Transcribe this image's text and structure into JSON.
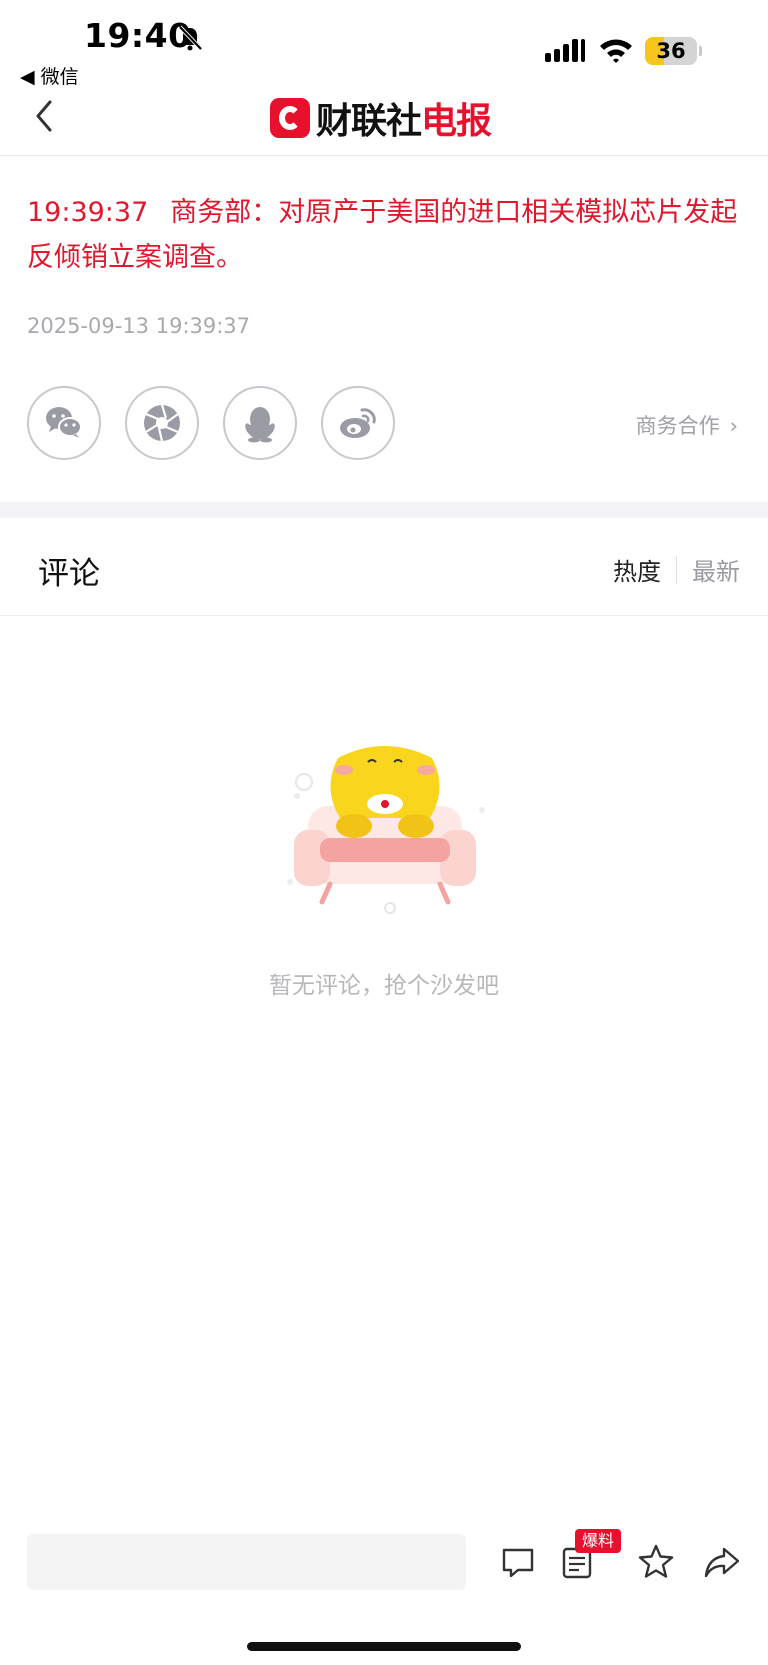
{
  "status_bar": {
    "time": "19:40",
    "back_app": "◀ 微信",
    "battery_percent": "36",
    "battery_level": 0.36
  },
  "nav": {
    "logo_text_a": "财联社",
    "logo_text_b": "电报"
  },
  "article": {
    "time": "19:39:37",
    "headline": "商务部：对原产于美国的进口相关模拟芯片发起反倾销立案调查。",
    "pub_date": "2025-09-13 19:39:37",
    "share_icons": [
      "wechat-icon",
      "moments-icon",
      "qq-icon",
      "weibo-icon"
    ],
    "business_link": "商务合作",
    "business_chevron": "›"
  },
  "comments": {
    "title": "评论",
    "sort_hot": "热度",
    "sort_new": "最新",
    "empty_text": "暂无评论，抢个沙发吧"
  },
  "bottom_bar": {
    "input_placeholder": "",
    "tip_badge": "爆料",
    "icons": [
      "comment-icon",
      "tip-doc-icon",
      "star-icon",
      "share-icon"
    ]
  },
  "colors": {
    "brand_red": "#e8112d",
    "headline_red": "#e0182d",
    "battery_yellow": "#f7c51c"
  }
}
